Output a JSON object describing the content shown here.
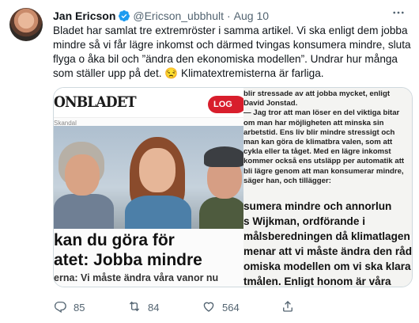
{
  "author": {
    "name": "Jan Ericson",
    "handle": "@Ericson_ubbhult",
    "separator": "·",
    "date": "Aug 10"
  },
  "tweet_lines": [
    "Bladet har samlat tre extremröster i samma artikel. Vi ska enligt dem jobba",
    "mindre så vi får lägre inkomst och därmed tvingas konsumera mindre, sluta",
    "flyga o åka bil och  ”ändra den ekonomiska modellen”. Undrar hur många",
    "som ställer upp på det. 😒 Klimatextremisterna är farliga."
  ],
  "image": {
    "masthead": "ONBLADET",
    "login_button": "LOG",
    "kicker": "Skandal",
    "headline_lines": [
      "kan du göra för",
      "atet: Jobba mindre"
    ],
    "subhead": "erna: Vi måste ändra våra vanor nu",
    "column_lines": [
      "blir stressade av att jobba mycket, enligt",
      "David Jonstad.",
      "— Jag tror att man löser en del viktiga bitar",
      "om man har möjligheten att minska sin",
      "arbetstid. Ens liv blir mindre stressigt och",
      "man kan göra de klimatbra valen, som att",
      "cykla eller ta tåget. Med en lägre inkomst",
      "kommer också ens utsläpp per automatik att",
      "bli lägre genom att man konsumerar mindre,",
      "säger han, och tillägger:"
    ],
    "big_lines": [
      "sumera mindre och annorlun",
      "s Wijkman, ordförande i",
      "målsberedningen då klimatlagen tog",
      "menar att vi måste ändra den rådar",
      "omiska modellen om vi ska klara",
      "tmålen. Enligt honom är våra"
    ]
  },
  "actions": {
    "replies": "85",
    "retweets": "84",
    "likes": "564"
  },
  "colors": {
    "verified": "#1d9bf0",
    "muted": "#536471",
    "login_red": "#d81e2c"
  },
  "icons": [
    "verified-badge-icon",
    "more-icon",
    "reply-icon",
    "retweet-icon",
    "like-icon",
    "share-icon"
  ]
}
